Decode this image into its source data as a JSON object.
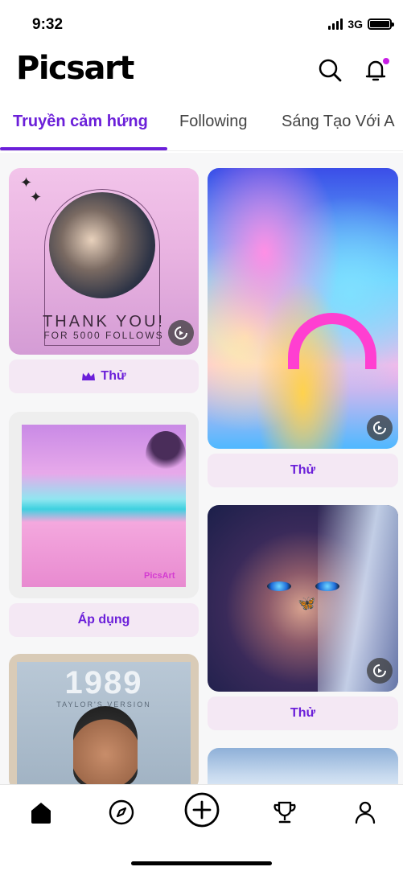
{
  "status_bar": {
    "time": "9:32",
    "network": "3G"
  },
  "header": {
    "logo": "Picsart"
  },
  "tabs": [
    {
      "label": "Truyền cảm hứng",
      "active": true
    },
    {
      "label": "Following",
      "active": false
    },
    {
      "label": "Sáng Tạo Với A",
      "active": false
    }
  ],
  "cards": {
    "thank_you": {
      "title": "THANK YOU!",
      "subtitle": "FOR 5000 FOLLOWS",
      "button": "Thử",
      "button_icon": "crown-icon"
    },
    "rainbow": {
      "button": "Thử"
    },
    "beach": {
      "button": "Áp dụng",
      "watermark": "PicsArt"
    },
    "portrait": {
      "button": "Thử"
    },
    "album": {
      "number": "1989",
      "caption": "TAYLOR'S VERSION"
    }
  },
  "nav": [
    "home-icon",
    "explore-icon",
    "create-icon",
    "challenges-icon",
    "profile-icon"
  ],
  "colors": {
    "accent": "#6b1fd9",
    "button_bg": "#f4e8f4",
    "notification_dot": "#c81ee5"
  }
}
